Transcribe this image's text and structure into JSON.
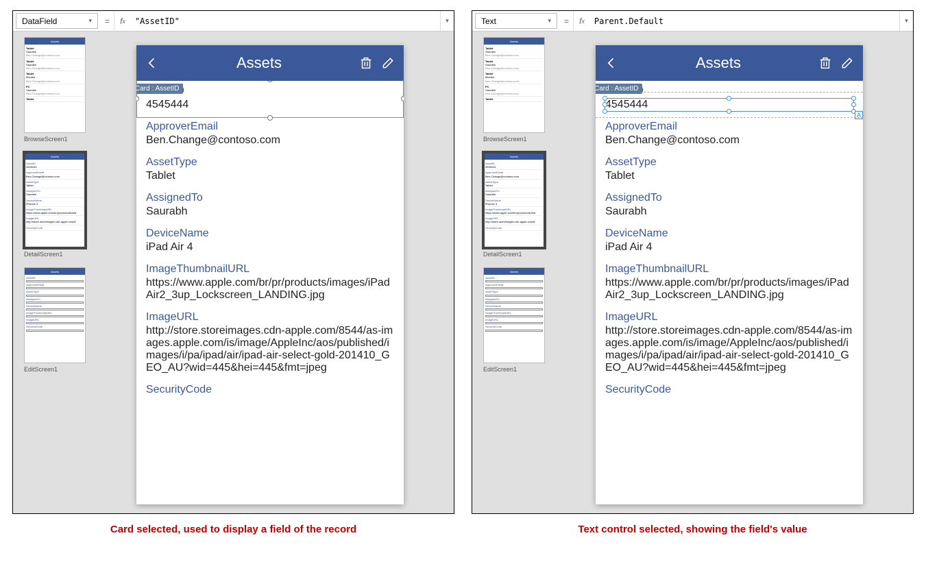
{
  "left": {
    "formula": {
      "property": "DataField",
      "value": "\"AssetID\""
    },
    "caption": "Card selected, used to display a field of the record",
    "tag": "Card : AssetID",
    "selection": "card"
  },
  "right": {
    "formula": {
      "property": "Text",
      "value": "Parent.Default"
    },
    "caption": "Text control selected, showing the field's value",
    "tag": "Card : AssetID",
    "selection": "text"
  },
  "screens": {
    "browse": "BrowseScreen1",
    "detail": "DetailScreen1",
    "edit": "EditScreen1"
  },
  "phone": {
    "title": "Assets",
    "fields": [
      {
        "label": "AssetID",
        "value": "4545444"
      },
      {
        "label": "ApproverEmail",
        "value": "Ben.Change@contoso.com"
      },
      {
        "label": "AssetType",
        "value": "Tablet"
      },
      {
        "label": "AssignedTo",
        "value": "Saurabh"
      },
      {
        "label": "DeviceName",
        "value": "iPad Air 4"
      },
      {
        "label": "ImageThumbnailURL",
        "value": "https://www.apple.com/br/pr/products/images/iPadAir2_3up_Lockscreen_LANDING.jpg"
      },
      {
        "label": "ImageURL",
        "value": "http://store.storeimages.cdn-apple.com/8544/as-images.apple.com/is/image/AppleInc/aos/published/images/i/pa/ipad/air/ipad-air-select-gold-201410_GEO_AU?wid=445&hei=445&fmt=jpeg"
      },
      {
        "label": "SecurityCode",
        "value": ""
      }
    ]
  },
  "browseThumb": {
    "title": "Assets",
    "rows": [
      {
        "t": "Tablet",
        "s": "Saurabh",
        "e": "Ben.Change@contoso.com"
      },
      {
        "t": "Tablet",
        "s": "Saurabh",
        "e": "Ben.Change@contoso.com"
      },
      {
        "t": "Tablet",
        "s": "Monika",
        "e": "Ben.Change@contoso.com"
      },
      {
        "t": "PC",
        "s": "Saurabh",
        "e": "Ben.Change@contoso.com"
      },
      {
        "t": "Tablet",
        "s": "",
        "e": ""
      }
    ]
  }
}
